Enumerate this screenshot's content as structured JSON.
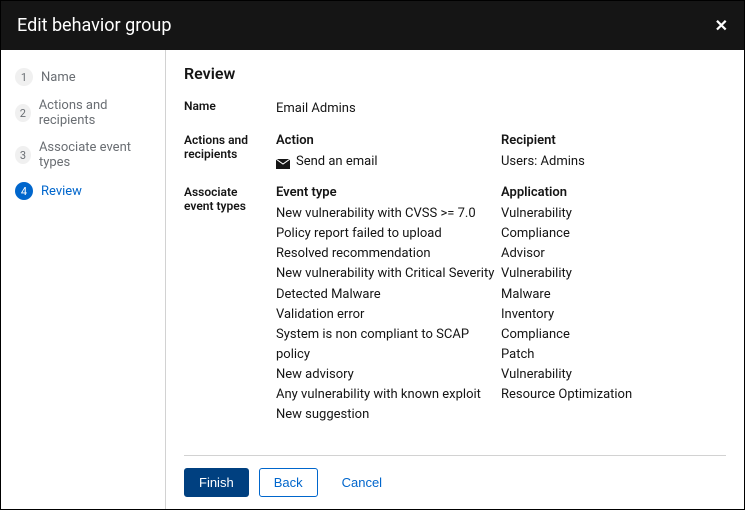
{
  "modal": {
    "title": "Edit behavior group"
  },
  "sidebar": {
    "steps": [
      {
        "num": "1",
        "label": "Name"
      },
      {
        "num": "2",
        "label": "Actions and recipients"
      },
      {
        "num": "3",
        "label": "Associate event types"
      },
      {
        "num": "4",
        "label": "Review"
      }
    ]
  },
  "main": {
    "title": "Review",
    "name_label": "Name",
    "name_value": "Email Admins",
    "actions_label": "Actions and recipients",
    "action_header": "Action",
    "action_value": "Send an email",
    "recipient_header": "Recipient",
    "recipient_value": "Users: Admins",
    "assoc_label": "Associate event types",
    "event_header": "Event type",
    "app_header": "Application",
    "events": [
      "New vulnerability with CVSS >= 7.0",
      "Policy report failed to upload",
      "Resolved recommendation",
      "New vulnerability with Critical Severity",
      "Detected Malware",
      "Validation error",
      "System is non compliant to SCAP policy",
      "New advisory",
      "Any vulnerability with known exploit",
      "New suggestion"
    ],
    "apps": [
      "Vulnerability",
      "Compliance",
      "Advisor",
      "Vulnerability",
      "Malware",
      "Inventory",
      "Compliance",
      "Patch",
      "Vulnerability",
      "Resource Optimization"
    ]
  },
  "footer": {
    "finish": "Finish",
    "back": "Back",
    "cancel": "Cancel"
  }
}
